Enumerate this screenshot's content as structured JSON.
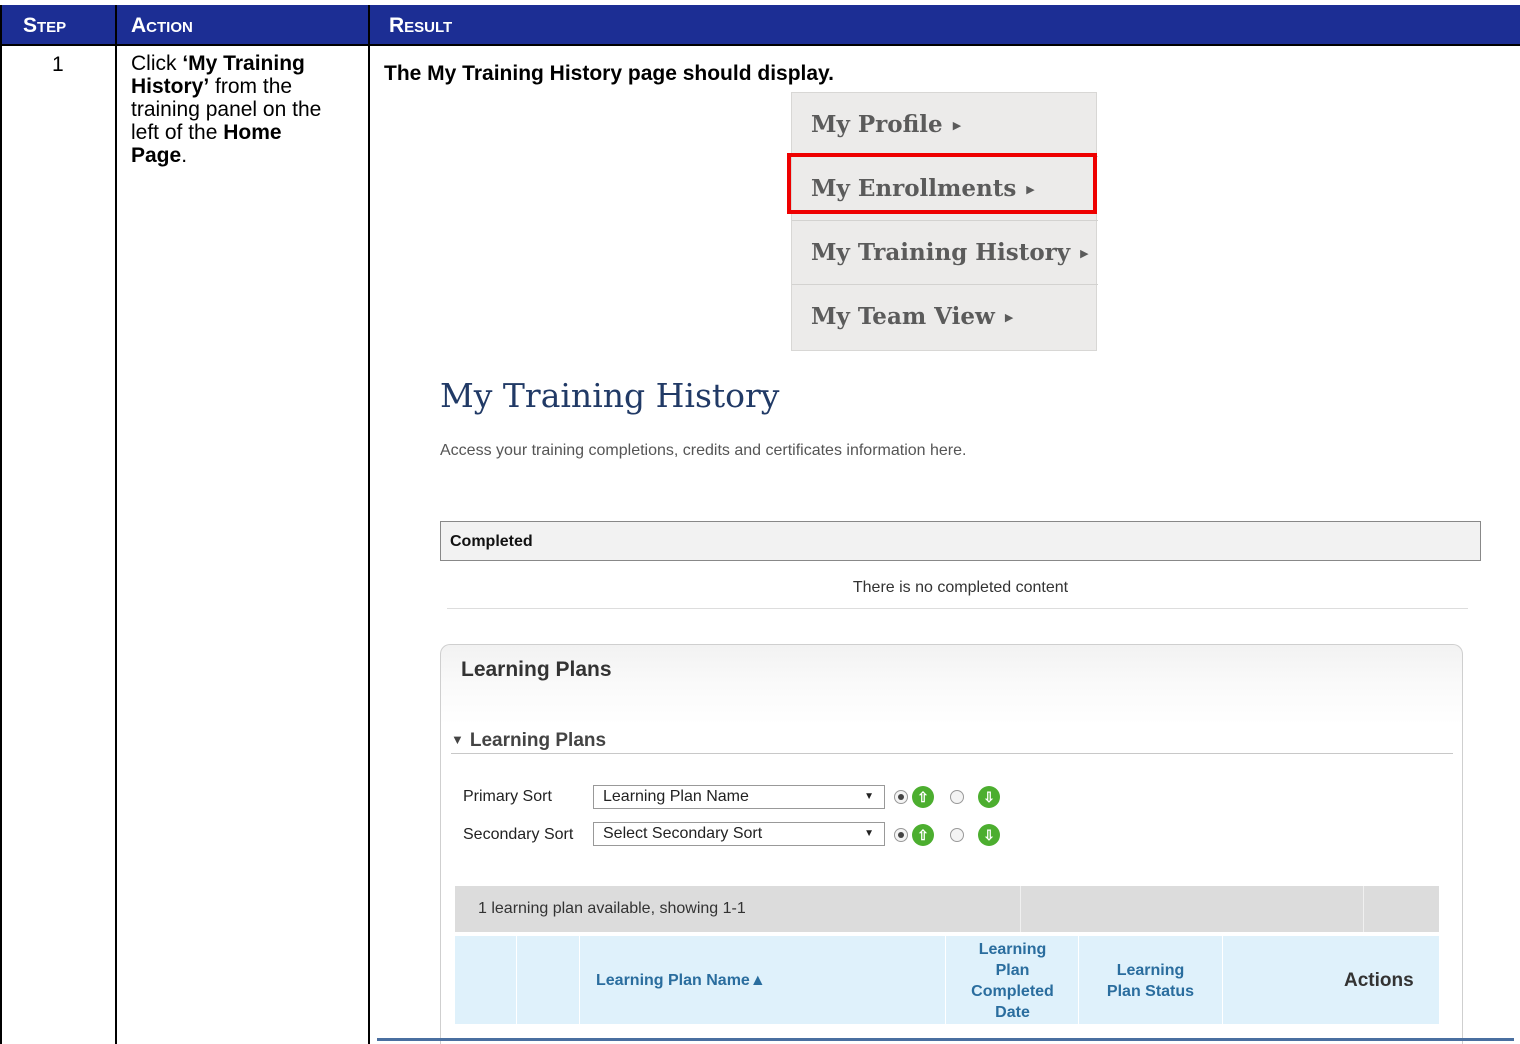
{
  "table": {
    "headers": [
      "Step",
      "Action",
      "Result"
    ],
    "step_number": "1",
    "action": {
      "part1": "Click ",
      "link_text": "‘My Training History’",
      "part2": " from the training panel on the left of the ",
      "home_page": "Home Page",
      "part3": "."
    },
    "result_title": "The My Training History page should display."
  },
  "menu": {
    "items": [
      "My Profile",
      "My Enrollments",
      "My Training History",
      "My Team View"
    ],
    "highlighted": "My Enrollments"
  },
  "page": {
    "heading": "My Training History",
    "subtitle": "Access your training completions, credits and certificates information here.",
    "completed_label": "Completed",
    "no_content": "There is no completed content"
  },
  "learning_plans": {
    "panel_title": "Learning Plans",
    "section_title": "Learning Plans",
    "primary_sort_label": "Primary Sort",
    "primary_sort_value": "Learning Plan Name",
    "secondary_sort_label": "Secondary Sort",
    "secondary_sort_value": "Select Secondary Sort",
    "count_text": "1 learning plan available, showing 1-1",
    "columns": {
      "name": "Learning Plan Name▲",
      "completed_l1": "Learning",
      "completed_l2": "Plan",
      "completed_l3": "Completed",
      "completed_l4": "Date",
      "status_l1": "Learning",
      "status_l2": "Plan Status",
      "actions": "Actions"
    }
  }
}
